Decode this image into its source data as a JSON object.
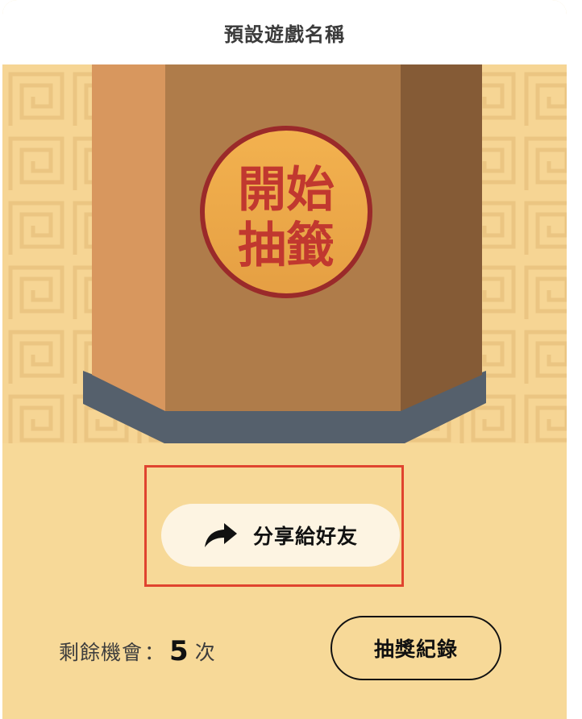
{
  "header": {
    "title": "預設遊戲名稱"
  },
  "draw_box": {
    "start_label_line1": "開始",
    "start_label_line2": "抽籤"
  },
  "share": {
    "label": "分享給好友",
    "icon": "share-arrow-icon"
  },
  "footer": {
    "remaining_label": "剩餘機會",
    "remaining_colon": "：",
    "remaining_count": "5",
    "remaining_unit": "次",
    "record_button_label": "抽獎紀錄"
  },
  "colors": {
    "background": "#F7D998",
    "box_front": "#AF7C4A",
    "box_left": "#D8975E",
    "box_right": "#855B36",
    "base": "#55606C",
    "badge_fill": "#EDA84A",
    "badge_ring": "#9A2A2A",
    "badge_text": "#C1382F",
    "highlight_frame": "#E0442F"
  }
}
